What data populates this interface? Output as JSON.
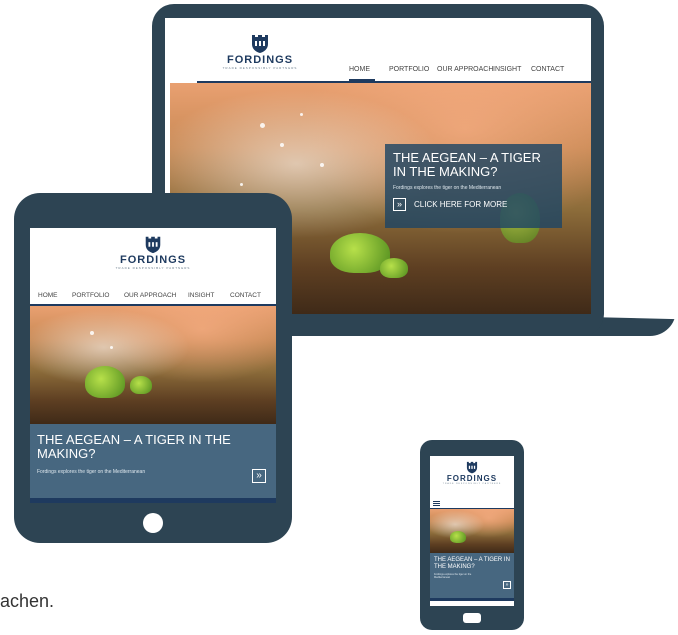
{
  "brand": {
    "name": "FORDINGS",
    "tagline": "TRADE RESPONSIBLY PARTNERS"
  },
  "nav": [
    "HOME",
    "PORTFOLIO",
    "OUR APPROACH",
    "INSIGHT",
    "CONTACT"
  ],
  "hero": {
    "title": "THE AEGEAN – A TIGER IN THE MAKING?",
    "subtitle": "Fordings explores the tiger on the Mediterranean",
    "cta": "CLICK HERE FOR MORE"
  },
  "icons": {
    "logo": "castle-shield-icon",
    "cta": "double-chevron-right-icon",
    "menu": "hamburger-menu-icon"
  },
  "colors": {
    "device": "#2d4453",
    "brand": "#1e3a5f",
    "overlay": "#1e4664"
  },
  "page_text": {
    "partial_word": "achen."
  }
}
